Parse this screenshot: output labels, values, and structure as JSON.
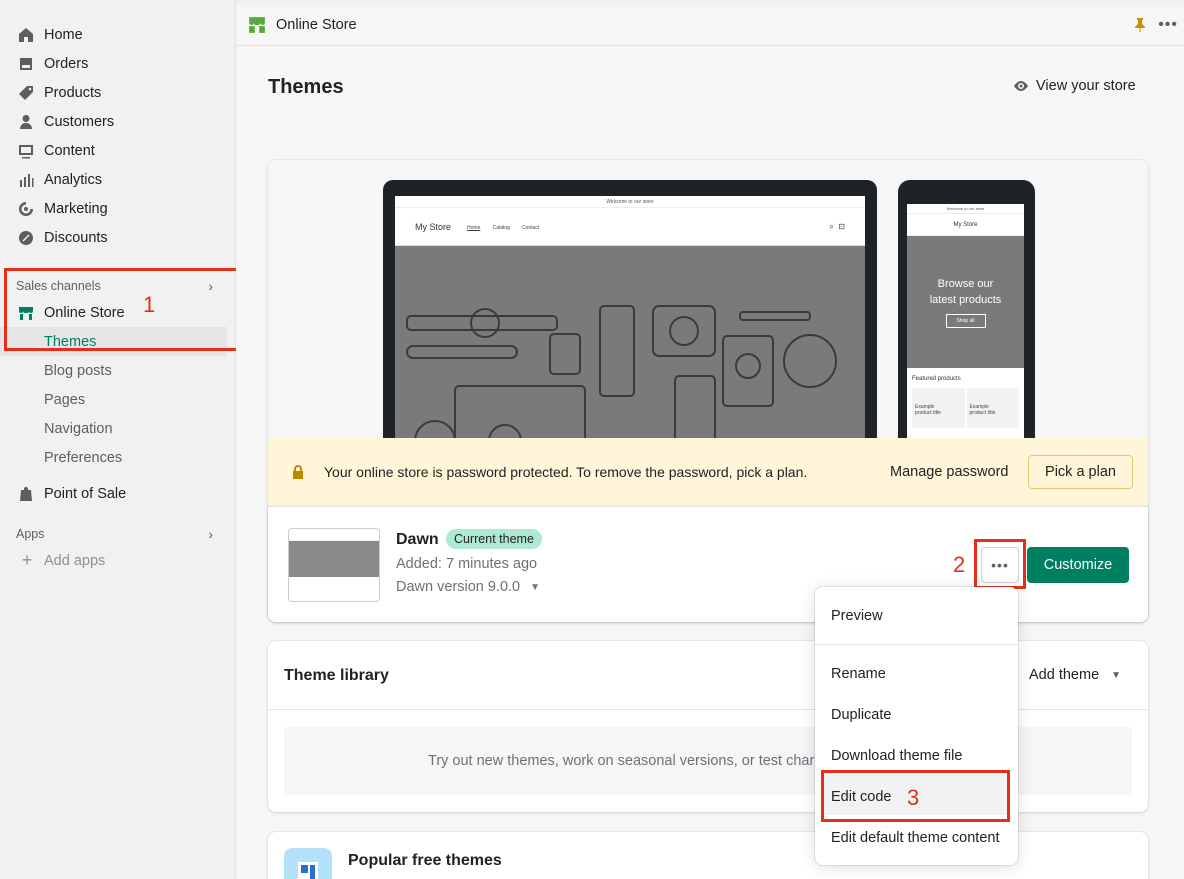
{
  "sidebar": {
    "nav": [
      {
        "label": "Home",
        "icon": "home-icon"
      },
      {
        "label": "Orders",
        "icon": "orders-icon"
      },
      {
        "label": "Products",
        "icon": "tag-icon"
      },
      {
        "label": "Customers",
        "icon": "person-icon"
      },
      {
        "label": "Content",
        "icon": "content-icon"
      },
      {
        "label": "Analytics",
        "icon": "bar-chart-icon"
      },
      {
        "label": "Marketing",
        "icon": "target-icon"
      },
      {
        "label": "Discounts",
        "icon": "discount-icon"
      }
    ],
    "sales_channels": "Sales channels",
    "online_store": "Online Store",
    "sub_items": [
      "Themes",
      "Blog posts",
      "Pages",
      "Navigation",
      "Preferences"
    ],
    "point_of_sale": "Point of Sale",
    "apps": "Apps",
    "add_apps": "Add apps"
  },
  "annotations": [
    "1",
    "2",
    "3"
  ],
  "topbar": {
    "title": "Online Store"
  },
  "page": {
    "title": "Themes",
    "view_store": "View your store"
  },
  "preview": {
    "announcement": "Welcome to our store",
    "store_name": "My Store",
    "links": [
      "Home",
      "Catalog",
      "Contact"
    ],
    "mobile_hero_line1": "Browse our",
    "mobile_hero_line2": "latest products",
    "mobile_shop": "Shop all",
    "featured": "Featured products",
    "product_line1": "Example",
    "product_line2": "product title"
  },
  "banner": {
    "message": "Your online store is password protected. To remove the password, pick a plan.",
    "manage": "Manage password",
    "pick": "Pick a plan",
    "color": "#fff5d9"
  },
  "theme": {
    "name": "Dawn",
    "badge": "Current theme",
    "added": "Added: 7 minutes ago",
    "version": "Dawn version 9.0.0",
    "customize": "Customize",
    "accent": "#008060"
  },
  "library": {
    "title": "Theme library",
    "add_theme": "Add theme",
    "empty_text": "Try out new themes, work on seasonal versions, or test char"
  },
  "popular": {
    "title": "Popular free themes"
  },
  "menu": {
    "items": [
      "Preview",
      "Rename",
      "Duplicate",
      "Download theme file",
      "Edit code",
      "Edit default theme content"
    ]
  }
}
